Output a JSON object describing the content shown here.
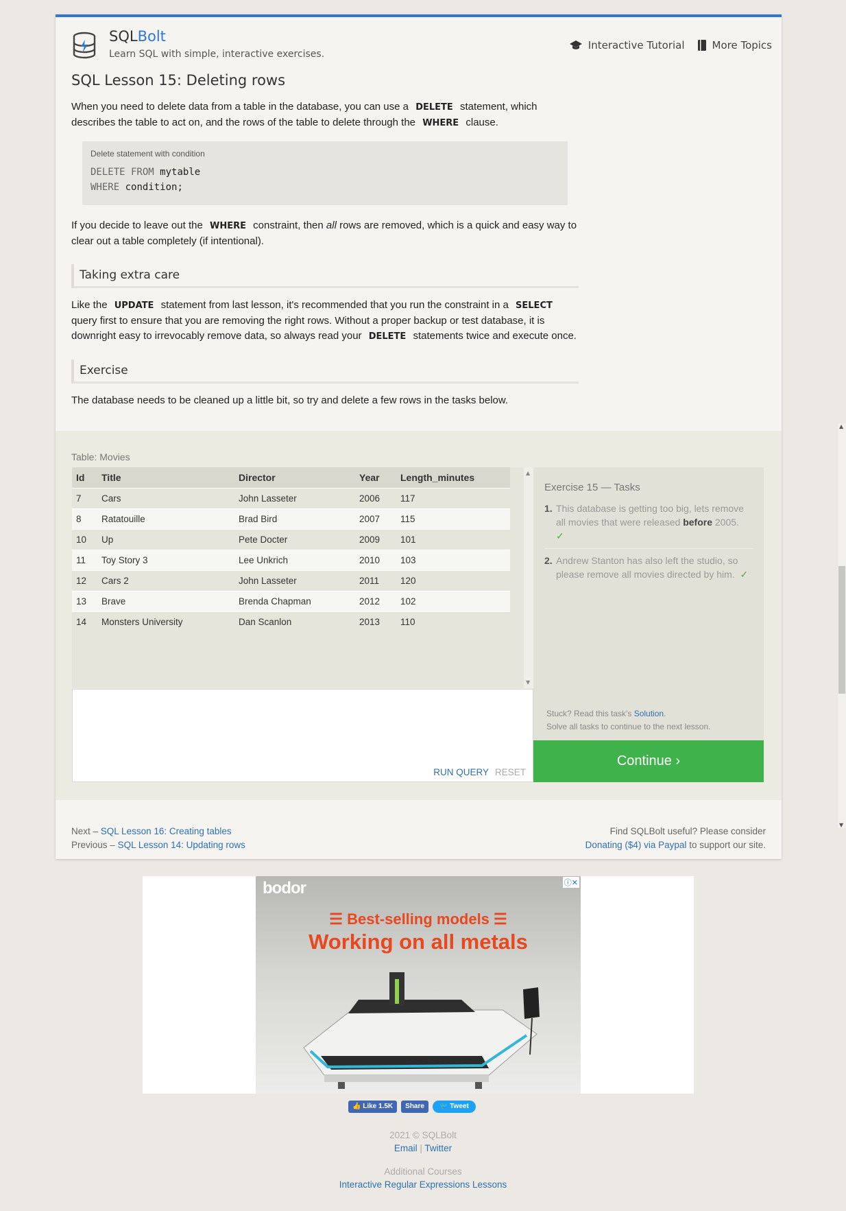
{
  "header": {
    "brand_sql": "SQL",
    "brand_bolt": "Bolt",
    "tagline": "Learn SQL with simple, interactive exercises.",
    "nav": [
      {
        "label": "Interactive Tutorial",
        "icon": "graduation-cap-icon"
      },
      {
        "label": "More Topics",
        "icon": "book-icon"
      }
    ]
  },
  "lesson": {
    "title": "SQL Lesson 15: Deleting rows",
    "intro_1": "When you need to delete data from a table in the database, you can use a",
    "kw_delete": "DELETE",
    "intro_2": "statement, which describes the table to act on, and the rows of the table to delete through the",
    "kw_where": "WHERE",
    "intro_3": "clause.",
    "code_caption": "Delete statement with condition",
    "code_kw1": "DELETE FROM",
    "code_val1": "mytable",
    "code_kw2": "WHERE",
    "code_val2": "condition;",
    "para2_1": "If you decide to leave out the",
    "para2_kw": "WHERE",
    "para2_2": "constraint, then",
    "para2_em": "all",
    "para2_3": "rows are removed, which is a quick and easy way to clear out a table completely (if intentional).",
    "sub1": "Taking extra care",
    "care_1": "Like the",
    "care_kw1": "UPDATE",
    "care_2": "statement from last lesson, it's recommended that you run the constraint in a",
    "care_kw2": "SELECT",
    "care_3": "query first to ensure that you are removing the right rows. Without a proper backup or test database, it is downright easy to irrevocably remove data, so always read your",
    "care_kw3": "DELETE",
    "care_4": "statements twice and execute once.",
    "sub2": "Exercise",
    "exercise_text": "The database needs to be cleaned up a little bit, so try and delete a few rows in the tasks below."
  },
  "exercise": {
    "table_caption": "Table: Movies",
    "columns": [
      "Id",
      "Title",
      "Director",
      "Year",
      "Length_minutes"
    ],
    "rows": [
      [
        "7",
        "Cars",
        "John Lasseter",
        "2006",
        "117"
      ],
      [
        "8",
        "Ratatouille",
        "Brad Bird",
        "2007",
        "115"
      ],
      [
        "10",
        "Up",
        "Pete Docter",
        "2009",
        "101"
      ],
      [
        "11",
        "Toy Story 3",
        "Lee Unkrich",
        "2010",
        "103"
      ],
      [
        "12",
        "Cars 2",
        "John Lasseter",
        "2011",
        "120"
      ],
      [
        "13",
        "Brave",
        "Brenda Chapman",
        "2012",
        "102"
      ],
      [
        "14",
        "Monsters University",
        "Dan Scanlon",
        "2013",
        "110"
      ]
    ],
    "run_label": "RUN QUERY",
    "reset_label": "RESET",
    "tasks_title": "Exercise 15 — Tasks",
    "task1_num": "1.",
    "task1_a": "This database is getting too big, lets remove all movies that were released",
    "task1_b": "before",
    "task1_c": "2005.",
    "task2_num": "2.",
    "task2": "Andrew Stanton has also left the studio, so please remove all movies directed by him.",
    "check": "✓",
    "stuck_1": "Stuck? Read this task's",
    "stuck_link": "Solution",
    "stuck_2": ".",
    "solve_all": "Solve all tasks to continue to the next lesson.",
    "continue_label": "Continue ›"
  },
  "pager": {
    "next_prefix": "Next –",
    "next_link": "SQL Lesson 16: Creating tables",
    "prev_prefix": "Previous –",
    "prev_link": "SQL Lesson 14: Updating rows",
    "support_1": "Find SQLBolt useful? Please consider",
    "support_link": "Donating ($4) via Paypal",
    "support_2": "to support our site."
  },
  "ad": {
    "brand": "bodor",
    "line1": "☰ Best-selling models ☰",
    "line2": "Working on all metals"
  },
  "social": {
    "like": "Like 1.5K",
    "share": "Share",
    "tweet": "Tweet"
  },
  "footer": {
    "copyright": "2021 © SQLBolt",
    "email": "Email",
    "sep": "|",
    "twitter": "Twitter",
    "additional": "Additional Courses",
    "regex": "Interactive Regular Expressions Lessons"
  },
  "colors": {
    "accent": "#2f77d0",
    "continue": "#3fb24c",
    "link": "#2f6fb0",
    "check": "#4caf50",
    "ad_text": "#e8481f"
  }
}
